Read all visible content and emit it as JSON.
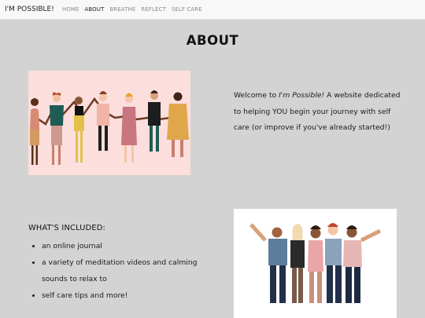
{
  "navbar": {
    "brand": "I'M POSSIBLE!",
    "items": [
      {
        "label": "HOME",
        "active": false
      },
      {
        "label": "ABOUT",
        "active": true
      },
      {
        "label": "BREATHE",
        "active": false
      },
      {
        "label": "REFLECT",
        "active": false
      },
      {
        "label": "SELF CARE",
        "active": false
      }
    ]
  },
  "page": {
    "title": "ABOUT"
  },
  "intro": {
    "prefix": "Welcome to ",
    "brand_italic": "I'm Possible!",
    "suffix": " A website dedicated to helping YOU begin your journey with self care (or improve if you've already started!)"
  },
  "included": {
    "heading": "WHAT'S INCLUDED:",
    "items": [
      "an online journal",
      "a variety of meditation videos and calming sounds to relax to",
      "self care tips and more!"
    ]
  },
  "images": {
    "top": {
      "alt": "illustration-people-holding-hands",
      "bg": "#fcdedd"
    },
    "bottom": {
      "alt": "illustration-friends-hugging",
      "bg": "#ffffff"
    }
  },
  "colors": {
    "background": "#d3d3d3",
    "navbar": "#f8f8f8",
    "nav_inactive": "#8a8a8a",
    "nav_active": "#222222"
  }
}
